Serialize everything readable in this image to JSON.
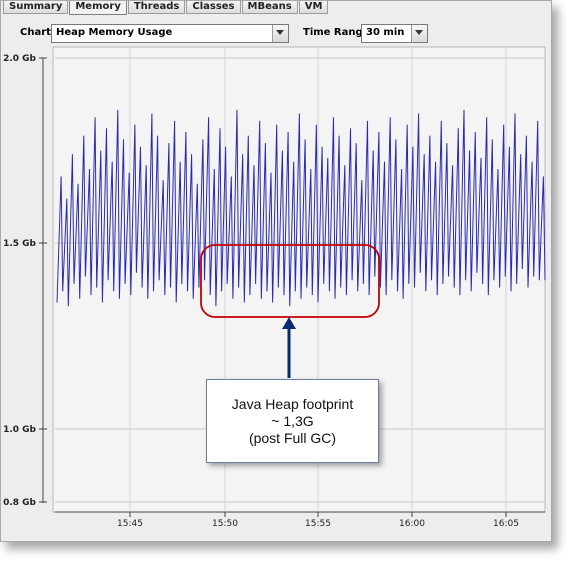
{
  "tabs": [
    {
      "label": "Summary",
      "active": false
    },
    {
      "label": "Memory",
      "active": true
    },
    {
      "label": "Threads",
      "active": false
    },
    {
      "label": "Classes",
      "active": false
    },
    {
      "label": "MBeans",
      "active": false
    },
    {
      "label": "VM",
      "active": false
    }
  ],
  "toolbar": {
    "chart_label": "Chart:",
    "chart_value": "Heap Memory Usage",
    "time_range_label": "Time Range:",
    "time_range_value": "30 min"
  },
  "annotation": {
    "line1": "Java Heap footprint",
    "line2": "~ 1,3G",
    "line3": "(post Full GC)"
  },
  "colors": {
    "series": "#2b2bb0",
    "highlight": "#c40000",
    "arrow": "#0a2a6e"
  },
  "chart_data": {
    "type": "line",
    "y_tick_labels": [
      "2.0 Gb",
      "1.5 Gb",
      "1.0 Gb",
      "0.8 Gb"
    ],
    "y_tick_values": [
      2.0,
      1.5,
      1.0,
      0.8
    ],
    "ylim": [
      0.8,
      2.0
    ],
    "x_tick_labels": [
      "15:45",
      "15:50",
      "15:55",
      "16:00",
      "16:05"
    ],
    "grid": true,
    "series": [
      {
        "peaks": [
          1.68,
          1.62,
          1.74,
          1.66,
          1.79,
          1.7,
          1.84,
          1.75,
          1.81,
          1.72,
          1.86,
          1.78,
          1.69,
          1.82,
          1.76,
          1.71,
          1.85,
          1.79,
          1.67,
          1.77,
          1.83,
          1.72,
          1.8,
          1.74,
          1.66,
          1.78,
          1.84,
          1.7,
          1.81,
          1.76,
          1.68,
          1.86,
          1.74,
          1.79,
          1.71,
          1.83,
          1.77,
          1.69,
          1.82,
          1.75,
          1.8,
          1.72,
          1.85,
          1.78,
          1.7,
          1.82,
          1.76,
          1.73,
          1.84,
          1.79,
          1.71,
          1.81,
          1.77,
          1.67,
          1.83,
          1.75,
          1.8,
          1.72,
          1.84,
          1.78,
          1.7,
          1.82,
          1.76,
          1.85,
          1.74,
          1.79,
          1.72,
          1.83,
          1.77,
          1.71,
          1.81,
          1.86,
          1.75,
          1.8,
          1.73,
          1.84,
          1.78,
          1.7,
          1.82,
          1.76,
          1.85,
          1.74,
          1.79,
          1.72,
          1.83,
          1.68
        ],
        "troughs": [
          1.34,
          1.37,
          1.33,
          1.39,
          1.35,
          1.41,
          1.36,
          1.38,
          1.34,
          1.4,
          1.37,
          1.35,
          1.39,
          1.36,
          1.42,
          1.38,
          1.35,
          1.37,
          1.4,
          1.36,
          1.38,
          1.34,
          1.39,
          1.37,
          1.35,
          1.38,
          1.4,
          1.36,
          1.33,
          1.37,
          1.39,
          1.35,
          1.38,
          1.34,
          1.36,
          1.39,
          1.35,
          1.37,
          1.34,
          1.38,
          1.36,
          1.33,
          1.37,
          1.35,
          1.38,
          1.36,
          1.34,
          1.39,
          1.37,
          1.35,
          1.38,
          1.36,
          1.4,
          1.37,
          1.39,
          1.36,
          1.41,
          1.38,
          1.36,
          1.4,
          1.37,
          1.35,
          1.39,
          1.38,
          1.42,
          1.37,
          1.4,
          1.36,
          1.39,
          1.41,
          1.38,
          1.36,
          1.4,
          1.37,
          1.42,
          1.39,
          1.36,
          1.4,
          1.38,
          1.41,
          1.37,
          1.39,
          1.43,
          1.38,
          1.41,
          1.4
        ]
      }
    ]
  }
}
